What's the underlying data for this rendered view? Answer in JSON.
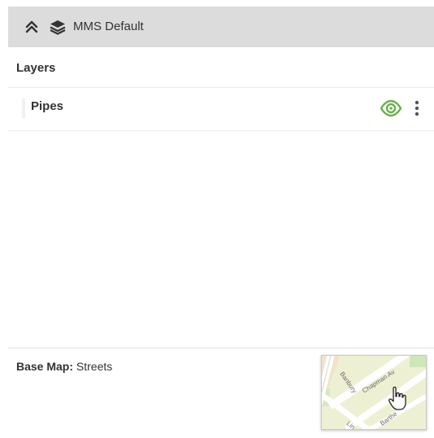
{
  "header": {
    "collapse_icon": "double-chevron-up-icon",
    "map_icon": "layers-stack-icon",
    "map_name": "MMS Default"
  },
  "layers_panel": {
    "heading": "Layers",
    "items": [
      {
        "name": "Pipes",
        "visible": true,
        "visibility_icon": "eye-icon",
        "menu_icon": "kebab-menu-icon"
      }
    ]
  },
  "basemap": {
    "label": "Base Map:",
    "value": "Streets",
    "thumbnail_street_labels": [
      "Banbury",
      "Chapman Av",
      "Barthe",
      "Lin"
    ]
  },
  "colors": {
    "header_bg": "#dcdcdc",
    "visible_eye": "#6ab04c",
    "text": "#333333"
  }
}
